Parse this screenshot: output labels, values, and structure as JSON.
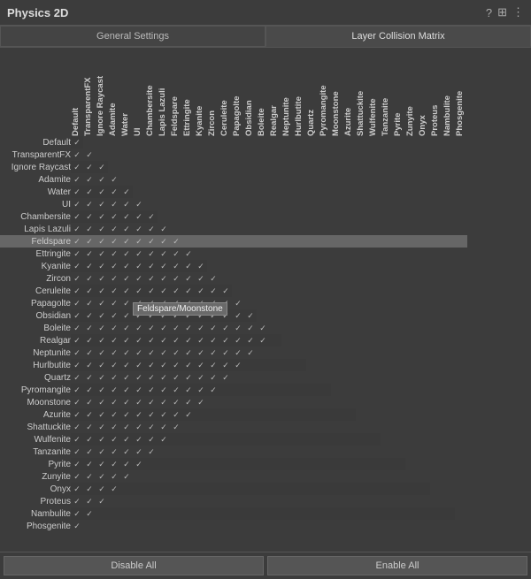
{
  "title": "Physics 2D",
  "tabs": [
    {
      "label": "General Settings",
      "active": false
    },
    {
      "label": "Layer Collision Matrix",
      "active": true
    }
  ],
  "columns": [
    "Default",
    "TransparentFX",
    "Ignore Raycast",
    "Adamite",
    "Water",
    "UI",
    "Chambersite",
    "Lapis Lazuli",
    "Feldspare",
    "Ettringite",
    "Kyanite",
    "Zircon",
    "Ceruleite",
    "Papagolte",
    "Obsidian",
    "Boleite",
    "Realgar",
    "Neptunite",
    "Hurlbutite",
    "Quartz",
    "Pyromangite",
    "Moonstone",
    "Azurite",
    "Shattuckite",
    "Wulfenite",
    "Tanzanite",
    "Pyrite",
    "Zunyite",
    "Onyx",
    "Proteus",
    "Nambulite",
    "Phosgenite"
  ],
  "rows": [
    {
      "label": "Default",
      "checks": [
        1,
        1,
        1,
        1,
        1,
        1,
        1,
        1,
        1,
        1,
        1,
        1,
        1,
        1,
        1,
        1,
        1,
        1,
        1,
        1,
        1,
        1,
        1,
        1,
        1,
        1,
        1,
        1,
        1,
        1,
        1,
        1
      ]
    },
    {
      "label": "TransparentFX",
      "checks": [
        1,
        1,
        1,
        1,
        1,
        1,
        1,
        1,
        1,
        1,
        1,
        1,
        1,
        1,
        1,
        1,
        1,
        1,
        1,
        1,
        1,
        1,
        1,
        1,
        1,
        1,
        1,
        1,
        1,
        1,
        1,
        0
      ]
    },
    {
      "label": "Ignore Raycast",
      "checks": [
        1,
        1,
        1,
        1,
        1,
        1,
        1,
        1,
        1,
        1,
        1,
        1,
        1,
        1,
        1,
        1,
        1,
        1,
        1,
        1,
        1,
        1,
        1,
        1,
        1,
        1,
        1,
        1,
        1,
        1,
        0,
        0
      ]
    },
    {
      "label": "Adamite",
      "checks": [
        1,
        1,
        1,
        1,
        1,
        1,
        1,
        1,
        1,
        1,
        1,
        1,
        1,
        1,
        1,
        1,
        1,
        1,
        1,
        1,
        1,
        1,
        1,
        1,
        1,
        1,
        1,
        1,
        1,
        0,
        0,
        0
      ]
    },
    {
      "label": "Water",
      "checks": [
        1,
        1,
        1,
        1,
        1,
        1,
        1,
        1,
        1,
        1,
        1,
        1,
        1,
        1,
        1,
        1,
        1,
        1,
        1,
        1,
        1,
        1,
        1,
        1,
        1,
        1,
        1,
        1,
        0,
        0,
        0,
        0
      ]
    },
    {
      "label": "UI",
      "checks": [
        1,
        1,
        1,
        1,
        1,
        1,
        1,
        1,
        1,
        1,
        1,
        1,
        1,
        1,
        1,
        1,
        1,
        1,
        1,
        1,
        1,
        1,
        1,
        1,
        1,
        1,
        1,
        0,
        0,
        0,
        0,
        0
      ]
    },
    {
      "label": "Chambersite",
      "checks": [
        1,
        1,
        1,
        1,
        1,
        1,
        1,
        1,
        1,
        1,
        1,
        1,
        1,
        1,
        1,
        1,
        1,
        1,
        1,
        1,
        1,
        1,
        1,
        1,
        1,
        1,
        0,
        0,
        0,
        0,
        0,
        0
      ]
    },
    {
      "label": "Lapis Lazuli",
      "checks": [
        1,
        1,
        1,
        1,
        1,
        1,
        1,
        1,
        1,
        1,
        1,
        1,
        1,
        1,
        1,
        1,
        1,
        1,
        1,
        1,
        1,
        1,
        1,
        1,
        1,
        0,
        0,
        0,
        0,
        0,
        0,
        0
      ]
    },
    {
      "label": "Feldspare",
      "checks": [
        1,
        1,
        1,
        1,
        1,
        1,
        1,
        1,
        1,
        1,
        1,
        1,
        1,
        1,
        1,
        1,
        1,
        1,
        1,
        1,
        1,
        1,
        1,
        1,
        0,
        0,
        0,
        0,
        0,
        0,
        0,
        0
      ],
      "highlight": true
    },
    {
      "label": "Ettringite",
      "checks": [
        1,
        1,
        1,
        1,
        1,
        1,
        1,
        1,
        1,
        1,
        1,
        1,
        1,
        1,
        1,
        1,
        1,
        1,
        1,
        1,
        1,
        1,
        1,
        0,
        0,
        0,
        0,
        0,
        0,
        0,
        0,
        0
      ]
    },
    {
      "label": "Kyanite",
      "checks": [
        1,
        1,
        1,
        1,
        1,
        1,
        1,
        1,
        1,
        1,
        1,
        1,
        1,
        1,
        1,
        1,
        1,
        1,
        1,
        1,
        1,
        1,
        0,
        0,
        0,
        0,
        0,
        0,
        0,
        0,
        0,
        0
      ]
    },
    {
      "label": "Zircon",
      "checks": [
        1,
        1,
        1,
        1,
        1,
        1,
        1,
        1,
        1,
        1,
        1,
        1,
        1,
        1,
        1,
        1,
        1,
        1,
        1,
        1,
        1,
        0,
        0,
        0,
        0,
        0,
        0,
        0,
        0,
        0,
        0,
        0
      ]
    },
    {
      "label": "Ceruleite",
      "checks": [
        1,
        1,
        1,
        1,
        1,
        1,
        1,
        1,
        1,
        1,
        1,
        1,
        1,
        1,
        1,
        1,
        1,
        1,
        1,
        1,
        0,
        0,
        0,
        0,
        0,
        0,
        0,
        0,
        0,
        0,
        0,
        0
      ]
    },
    {
      "label": "Papagolte",
      "checks": [
        1,
        1,
        1,
        1,
        1,
        1,
        1,
        1,
        1,
        1,
        1,
        1,
        1,
        1,
        1,
        1,
        1,
        1,
        1,
        0,
        0,
        0,
        0,
        0,
        0,
        0,
        0,
        0,
        0,
        0,
        0,
        0
      ]
    },
    {
      "label": "Obsidian",
      "checks": [
        1,
        1,
        1,
        1,
        1,
        1,
        1,
        1,
        1,
        1,
        1,
        1,
        1,
        1,
        1,
        1,
        1,
        1,
        0,
        0,
        0,
        0,
        0,
        0,
        0,
        0,
        0,
        0,
        0,
        0,
        0,
        0
      ]
    },
    {
      "label": "Boleite",
      "checks": [
        1,
        1,
        1,
        1,
        1,
        1,
        1,
        1,
        1,
        1,
        1,
        1,
        1,
        1,
        1,
        1,
        1,
        0,
        0,
        0,
        0,
        0,
        0,
        0,
        0,
        0,
        0,
        0,
        0,
        0,
        0,
        0
      ]
    },
    {
      "label": "Realgar",
      "checks": [
        1,
        1,
        1,
        1,
        1,
        1,
        1,
        1,
        1,
        1,
        1,
        1,
        1,
        1,
        1,
        1,
        0,
        0,
        0,
        0,
        0,
        0,
        0,
        0,
        0,
        0,
        0,
        0,
        0,
        0,
        0,
        0
      ]
    },
    {
      "label": "Neptunite",
      "checks": [
        1,
        1,
        1,
        1,
        1,
        1,
        1,
        1,
        1,
        1,
        1,
        1,
        1,
        1,
        1,
        0,
        0,
        0,
        0,
        0,
        0,
        0,
        0,
        0,
        0,
        0,
        0,
        0,
        0,
        0,
        0,
        0
      ]
    },
    {
      "label": "Hurlbutite",
      "checks": [
        1,
        1,
        1,
        1,
        1,
        1,
        1,
        1,
        1,
        1,
        1,
        1,
        1,
        1,
        0,
        0,
        0,
        0,
        0,
        0,
        0,
        0,
        0,
        0,
        0,
        0,
        0,
        0,
        0,
        0,
        0,
        0
      ]
    },
    {
      "label": "Quartz",
      "checks": [
        1,
        1,
        1,
        1,
        1,
        1,
        1,
        1,
        1,
        1,
        1,
        1,
        1,
        0,
        0,
        0,
        0,
        0,
        0,
        0,
        0,
        0,
        0,
        0,
        0,
        0,
        0,
        0,
        0,
        0,
        0,
        0
      ]
    },
    {
      "label": "Pyromangite",
      "checks": [
        1,
        1,
        1,
        1,
        1,
        1,
        1,
        1,
        1,
        1,
        1,
        1,
        0,
        0,
        0,
        0,
        0,
        0,
        0,
        0,
        0,
        0,
        0,
        0,
        0,
        0,
        0,
        0,
        0,
        0,
        0,
        0
      ]
    },
    {
      "label": "Moonstone",
      "checks": [
        1,
        1,
        1,
        1,
        1,
        1,
        1,
        1,
        1,
        1,
        1,
        0,
        0,
        0,
        0,
        0,
        0,
        0,
        0,
        0,
        0,
        0,
        0,
        0,
        0,
        0,
        0,
        0,
        0,
        0,
        0,
        0
      ]
    },
    {
      "label": "Azurite",
      "checks": [
        1,
        1,
        1,
        1,
        1,
        1,
        1,
        1,
        1,
        1,
        0,
        0,
        0,
        0,
        0,
        0,
        0,
        0,
        0,
        0,
        0,
        0,
        0,
        0,
        0,
        0,
        0,
        0,
        0,
        0,
        0,
        0
      ]
    },
    {
      "label": "Shattuckite",
      "checks": [
        1,
        1,
        1,
        1,
        1,
        1,
        1,
        1,
        1,
        0,
        0,
        0,
        0,
        0,
        0,
        0,
        0,
        0,
        0,
        0,
        0,
        0,
        0,
        0,
        0,
        0,
        0,
        0,
        0,
        0,
        0,
        0
      ]
    },
    {
      "label": "Wulfenite",
      "checks": [
        1,
        1,
        1,
        1,
        1,
        1,
        1,
        1,
        0,
        0,
        0,
        0,
        0,
        0,
        0,
        0,
        0,
        0,
        0,
        0,
        0,
        0,
        0,
        0,
        0,
        0,
        0,
        0,
        0,
        0,
        0,
        0
      ]
    },
    {
      "label": "Tanzanite",
      "checks": [
        1,
        1,
        1,
        1,
        1,
        1,
        1,
        0,
        0,
        0,
        0,
        0,
        0,
        0,
        0,
        0,
        0,
        0,
        0,
        0,
        0,
        0,
        0,
        0,
        0,
        0,
        0,
        0,
        0,
        0,
        0,
        0
      ]
    },
    {
      "label": "Pyrite",
      "checks": [
        1,
        1,
        1,
        1,
        1,
        1,
        0,
        0,
        0,
        0,
        0,
        0,
        0,
        0,
        0,
        0,
        0,
        0,
        0,
        0,
        0,
        0,
        0,
        0,
        0,
        0,
        0,
        0,
        0,
        0,
        0,
        0
      ]
    },
    {
      "label": "Zunyite",
      "checks": [
        1,
        1,
        1,
        1,
        1,
        0,
        0,
        0,
        0,
        0,
        0,
        0,
        0,
        0,
        0,
        0,
        0,
        0,
        0,
        0,
        0,
        0,
        0,
        0,
        0,
        0,
        0,
        0,
        0,
        0,
        0,
        0
      ]
    },
    {
      "label": "Onyx",
      "checks": [
        1,
        1,
        1,
        1,
        0,
        0,
        0,
        0,
        0,
        0,
        0,
        0,
        0,
        0,
        0,
        0,
        0,
        0,
        0,
        0,
        0,
        0,
        0,
        0,
        0,
        0,
        0,
        0,
        0,
        0,
        0,
        0
      ]
    },
    {
      "label": "Proteus",
      "checks": [
        1,
        1,
        1,
        0,
        0,
        0,
        0,
        0,
        0,
        0,
        0,
        0,
        0,
        0,
        0,
        0,
        0,
        0,
        0,
        0,
        0,
        0,
        0,
        0,
        0,
        0,
        0,
        0,
        0,
        0,
        0,
        0
      ]
    },
    {
      "label": "Nambulite",
      "checks": [
        1,
        1,
        0,
        0,
        0,
        0,
        0,
        0,
        0,
        0,
        0,
        0,
        0,
        0,
        0,
        0,
        0,
        0,
        0,
        0,
        0,
        0,
        0,
        0,
        0,
        0,
        0,
        0,
        0,
        0,
        0,
        0
      ]
    },
    {
      "label": "Phosgenite",
      "checks": [
        1,
        0,
        0,
        0,
        0,
        0,
        0,
        0,
        0,
        0,
        0,
        0,
        0,
        0,
        0,
        0,
        0,
        0,
        0,
        0,
        0,
        0,
        0,
        0,
        0,
        0,
        0,
        0,
        0,
        0,
        0,
        0
      ]
    }
  ],
  "buttons": {
    "disable_all": "Disable All",
    "enable_all": "Enable All"
  },
  "tooltip": "Feldspare/Moonstone",
  "icons": {
    "help": "?",
    "layout": "⊞",
    "menu": "⋮"
  }
}
